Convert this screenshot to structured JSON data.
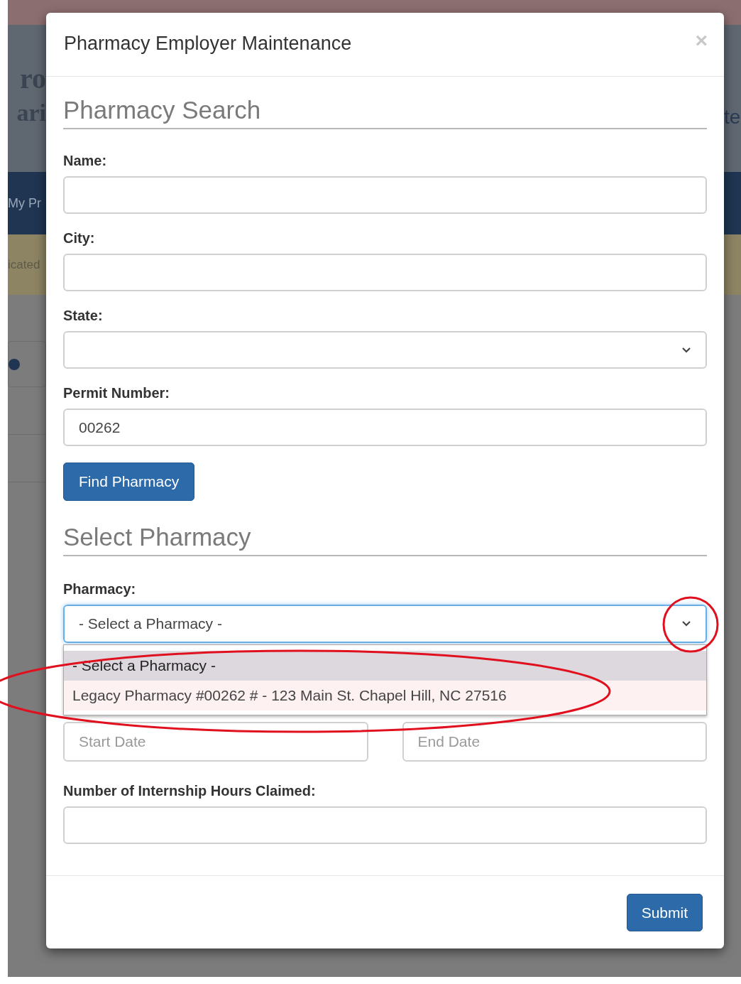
{
  "background": {
    "left_fragments": [
      "ro",
      "ari",
      "My Pr",
      "icated"
    ],
    "right_fragment": "te"
  },
  "modal": {
    "title": "Pharmacy Employer Maintenance",
    "close": "×",
    "search": {
      "heading": "Pharmacy Search",
      "fields": [
        {
          "kind": "text",
          "label": "Name:"
        },
        {
          "kind": "text",
          "label": "City:"
        },
        {
          "kind": "select",
          "label": "State:"
        },
        {
          "kind": "text",
          "label": "Permit Number:",
          "value": "00262"
        }
      ],
      "button": "Find Pharmacy"
    },
    "select": {
      "heading": "Select Pharmacy",
      "label": "Pharmacy:",
      "value": "- Select a Pharmacy -",
      "expanded": true,
      "options": [
        {
          "label": "- Select a Pharmacy -",
          "selected": true
        },
        {
          "label": "Legacy Pharmacy #00262 # - 123 Main St. Chapel Hill, NC 27516",
          "selected": false
        }
      ]
    },
    "period": {
      "start_placeholder": "Start Date",
      "end_placeholder": "End Date"
    },
    "hours": {
      "label": "Number of Internship Hours Claimed:"
    },
    "submit": "Submit"
  }
}
